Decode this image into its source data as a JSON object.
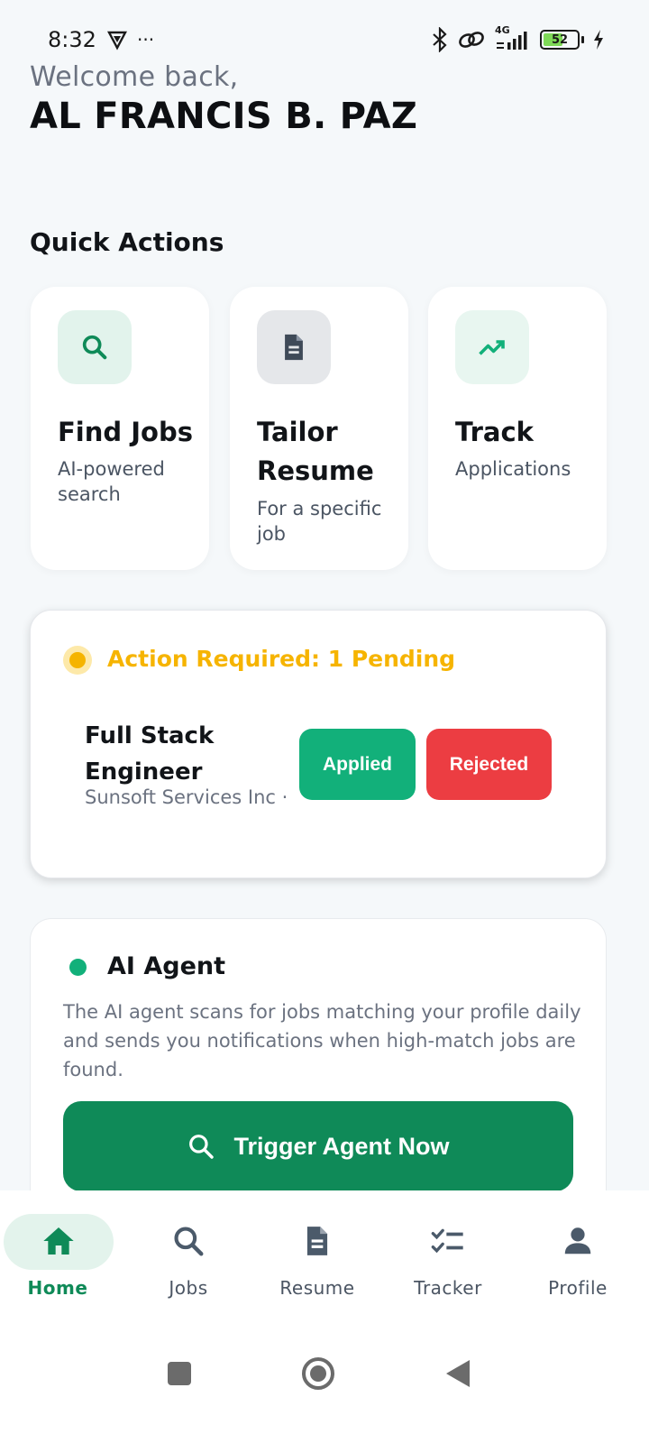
{
  "status_bar": {
    "time": "8:32",
    "more": "···",
    "network": "4G",
    "battery": "52"
  },
  "header": {
    "welcome": "Welcome back,",
    "user_name": "AL FRANCIS B. PAZ"
  },
  "quick_actions": {
    "title": "Quick Actions",
    "items": [
      {
        "title": "Find Jobs",
        "subtitle": "AI-powered search",
        "icon": "search-icon",
        "icon_bg": "#e2f3ec",
        "icon_color": "#0f8a58"
      },
      {
        "title": "Tailor Resume",
        "subtitle": "For a specific job",
        "icon": "document-icon",
        "icon_bg": "#e5e7ea",
        "icon_color": "#3f4a58"
      },
      {
        "title": "Track",
        "subtitle": "Applications",
        "icon": "trending-up-icon",
        "icon_bg": "#e8f6f0",
        "icon_color": "#12b07a"
      }
    ]
  },
  "action_required": {
    "label": "Action Required: 1 Pending",
    "job_title": "Full Stack Engineer",
    "company": "Sunsoft Services Inc ·",
    "applied_label": "Applied",
    "rejected_label": "Rejected"
  },
  "ai_agent": {
    "title": "AI Agent",
    "description": "The AI agent scans for jobs matching your profile daily and sends you notifications when high-match jobs are found.",
    "trigger_label": "Trigger Agent Now"
  },
  "bottom_nav": {
    "items": [
      {
        "label": "Home",
        "icon": "home-icon",
        "active": true
      },
      {
        "label": "Jobs",
        "icon": "search-icon"
      },
      {
        "label": "Resume",
        "icon": "document-icon"
      },
      {
        "label": "Tracker",
        "icon": "checklist-icon"
      },
      {
        "label": "Profile",
        "icon": "person-icon"
      }
    ]
  },
  "colors": {
    "brand_green": "#0f8a58",
    "applied_green": "#12b07a",
    "rejected_red": "#ec3d42",
    "pending_amber": "#f6b400",
    "background": "#f5f8fa"
  }
}
